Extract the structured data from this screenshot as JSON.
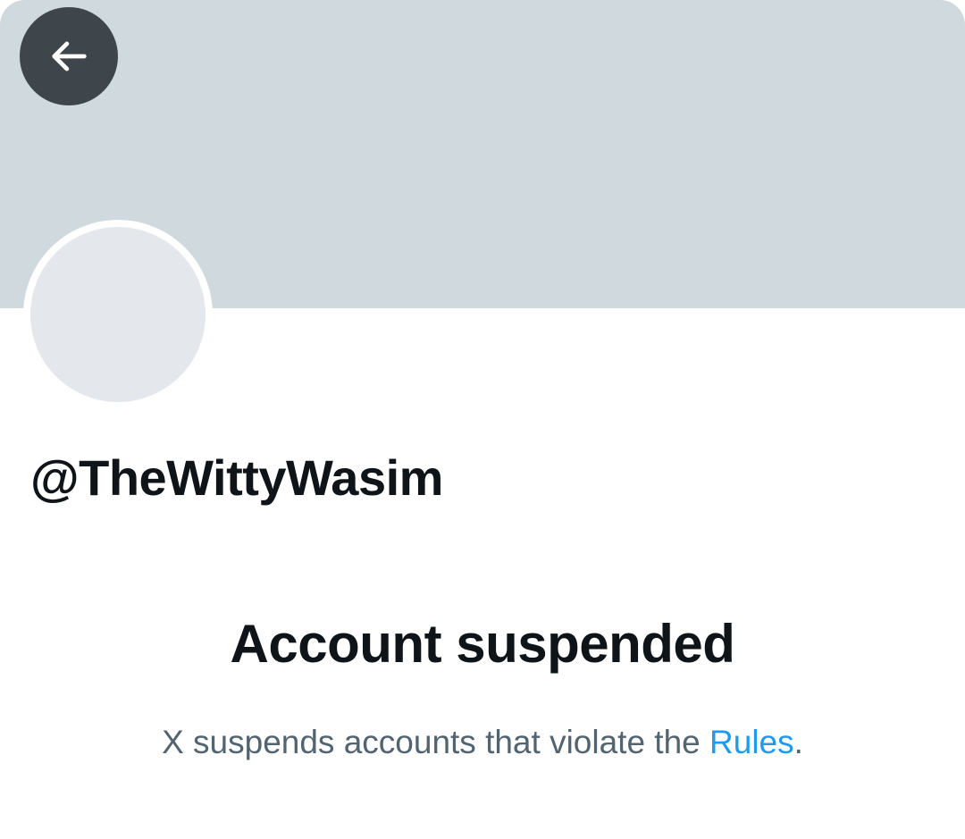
{
  "profile": {
    "handle": "@TheWittyWasim"
  },
  "suspension": {
    "title": "Account suspended",
    "description_prefix": "X suspends accounts that violate the ",
    "rules_link": "Rules",
    "description_suffix": "."
  },
  "icons": {
    "back": "back-arrow-icon"
  },
  "colors": {
    "banner": "#cfd9de",
    "avatar": "#e4e8ec",
    "text_primary": "#0f1419",
    "text_secondary": "#536471",
    "link": "#1d9bf0",
    "back_button_bg": "#0f1419"
  }
}
